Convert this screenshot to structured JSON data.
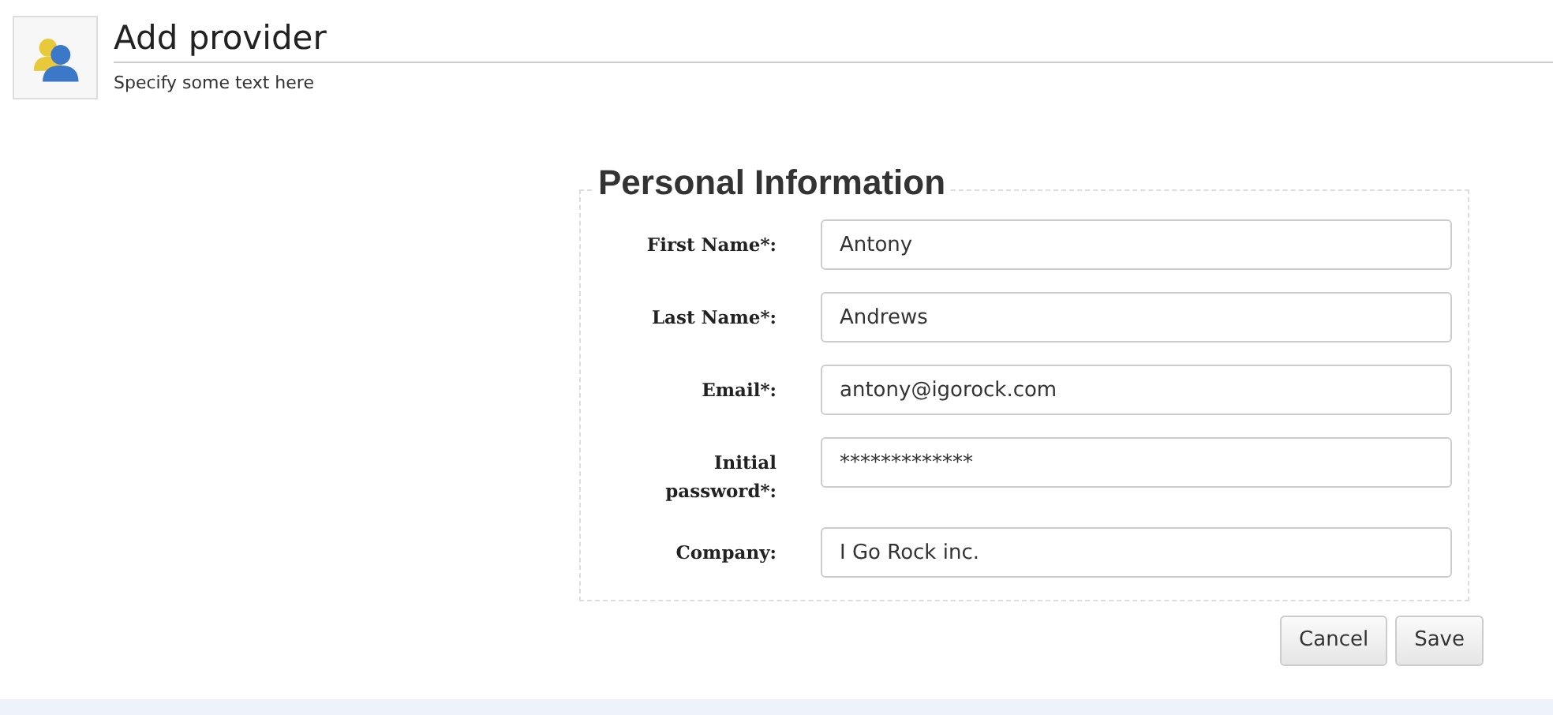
{
  "header": {
    "title": "Add provider",
    "subtitle": "Specify some text here"
  },
  "form": {
    "legend": "Personal Information",
    "fields": [
      {
        "label": "First Name*:",
        "value": "Antony"
      },
      {
        "label": "Last Name*:",
        "value": "Andrews"
      },
      {
        "label": "Email*:",
        "value": "antony@igorock.com"
      },
      {
        "label": "Initial password*:",
        "value": "*************"
      },
      {
        "label": "Company:",
        "value": "I Go Rock inc."
      }
    ]
  },
  "buttons": [
    "Cancel",
    "Save"
  ]
}
